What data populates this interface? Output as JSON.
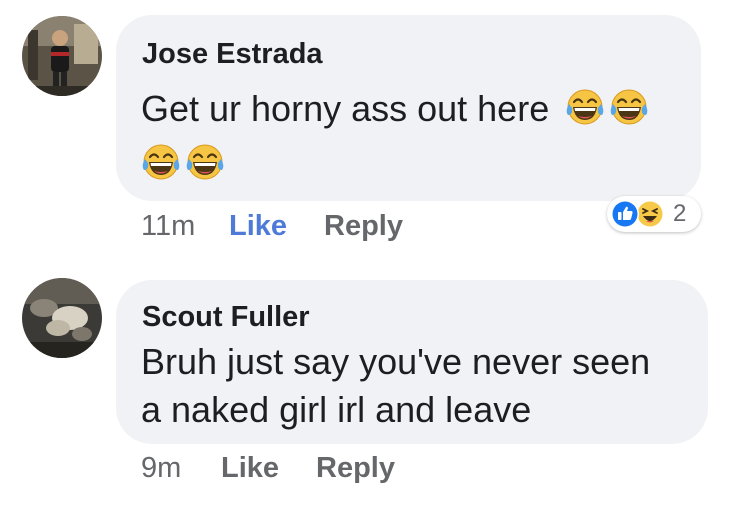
{
  "comments": [
    {
      "author": "Jose Estrada",
      "text_lines": [
        "Get ur horny ass out here"
      ],
      "emoji": "laughing-tears",
      "time": "11m",
      "like_label": "Like",
      "reply_label": "Reply",
      "liked": true,
      "reactions": {
        "types": [
          "like-icon",
          "haha-icon"
        ],
        "count": "2"
      }
    },
    {
      "author": "Scout Fuller",
      "text_lines": [
        "Bruh just say you've never seen",
        "a naked girl irl and leave"
      ],
      "time": "9m",
      "like_label": "Like",
      "reply_label": "Reply",
      "liked": false
    }
  ],
  "colors": {
    "bubble": "#f0f2f5",
    "liked_blue": "#4e7bd8",
    "meta_gray": "#65676b",
    "text": "#1c1e21"
  }
}
